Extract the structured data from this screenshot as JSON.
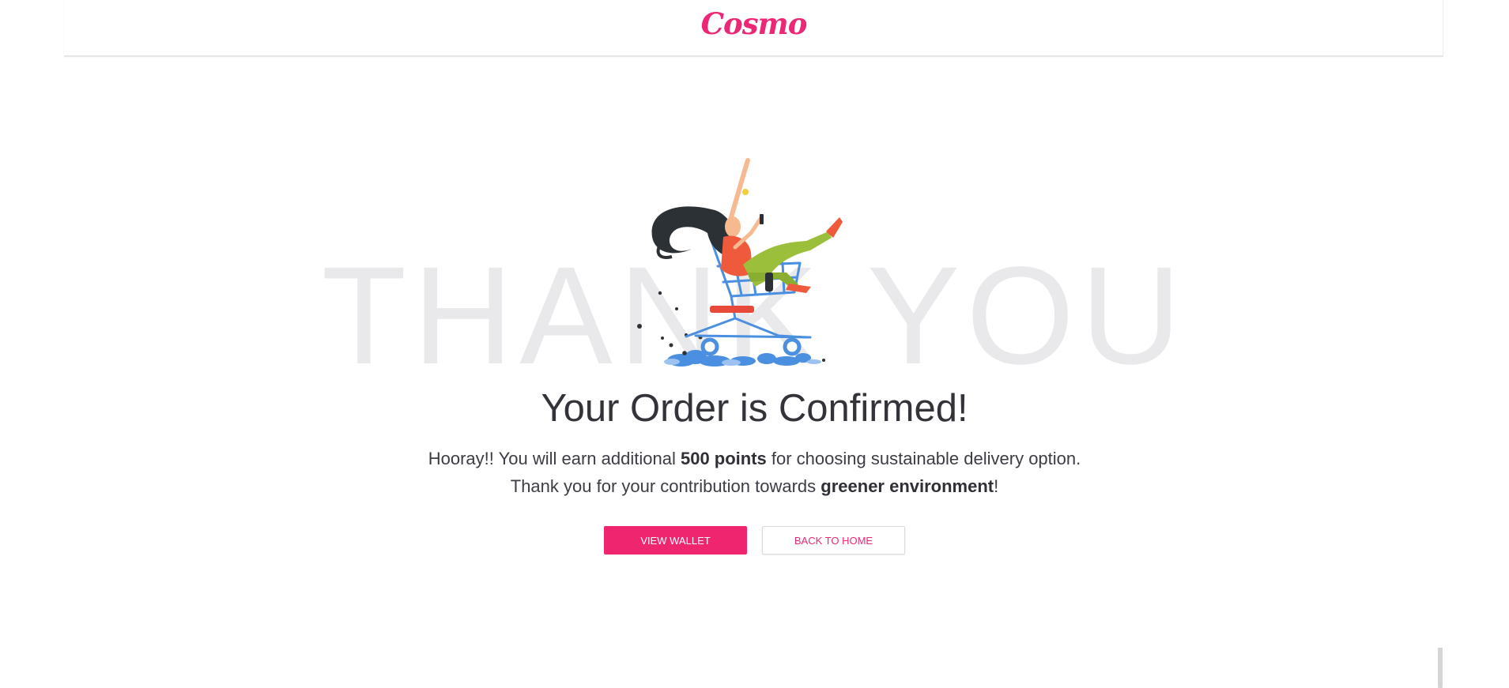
{
  "header": {
    "logo_text": "Cosmo",
    "brand_color": "#ec2775"
  },
  "hero": {
    "watermark_text": "THANK YOU",
    "illustration": "woman-riding-shopping-cart-illustration"
  },
  "confirmation": {
    "title": "Your Order is Confirmed!",
    "line1_prefix": "Hooray!! You will earn additional ",
    "line1_bold": "500 points",
    "line1_suffix": " for choosing sustainable delivery option.",
    "line2_prefix": "Thank you for your contribution towards ",
    "line2_bold": "greener environment",
    "line2_suffix": "!"
  },
  "actions": {
    "view_wallet_label": "VIEW WALLET",
    "back_home_label": "BACK TO HOME"
  },
  "colors": {
    "accent": "#f0256f",
    "text": "#33333a",
    "watermark": "#e9e9ec"
  }
}
